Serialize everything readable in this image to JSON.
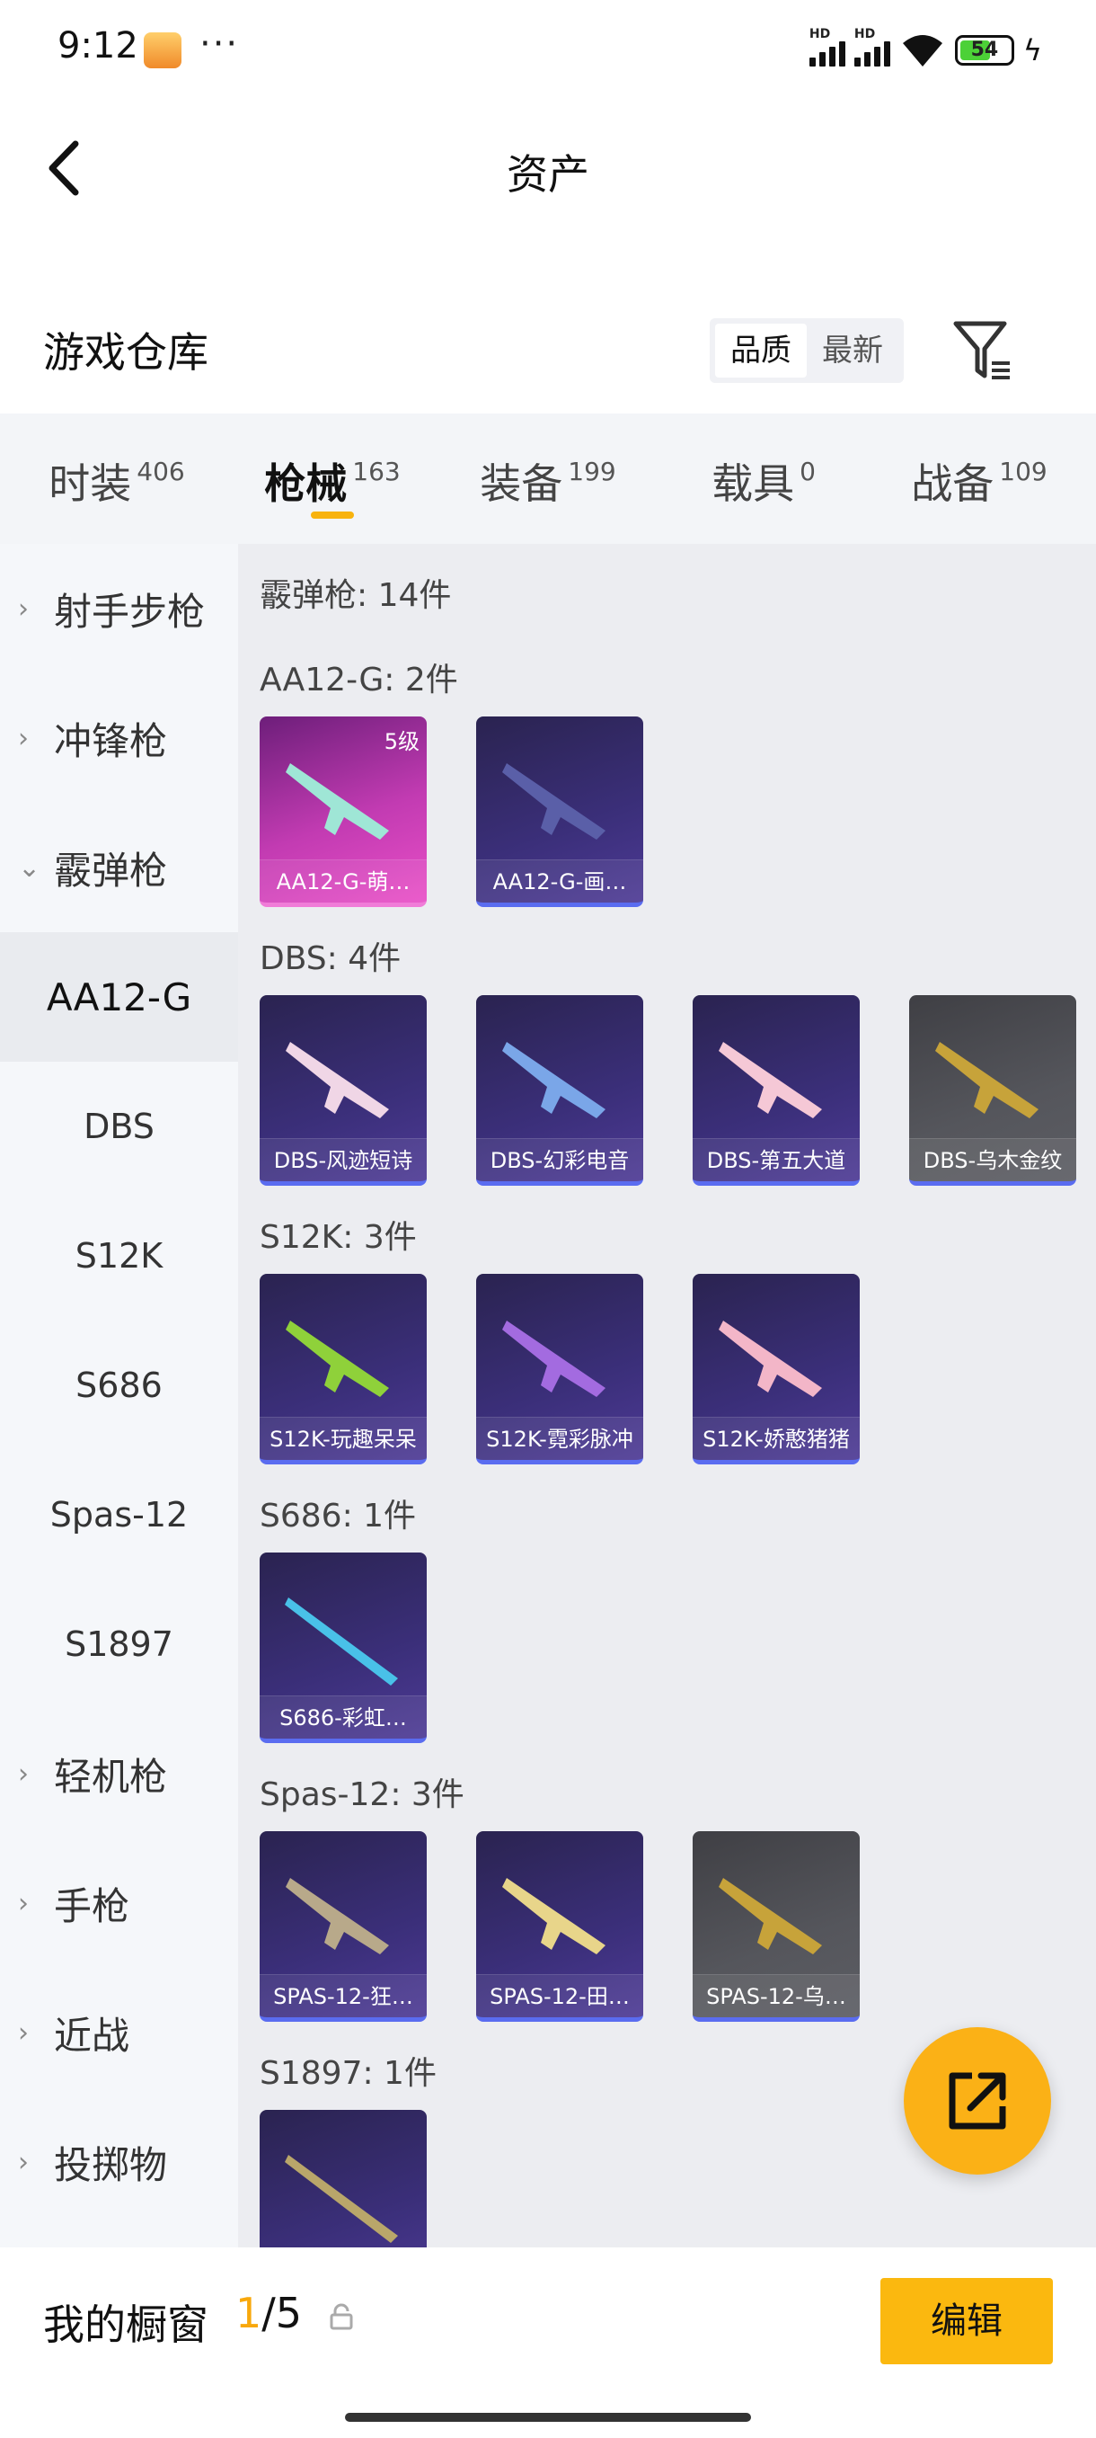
{
  "status": {
    "time": "9:12",
    "dots": "···",
    "battery": "54",
    "net1": "HD",
    "net2": "HD"
  },
  "header": {
    "title": "资产"
  },
  "warehouse": {
    "title": "游戏仓库",
    "sort_quality": "品质",
    "sort_newest": "最新"
  },
  "tabs": [
    {
      "label": "时装",
      "count": "406"
    },
    {
      "label": "枪械",
      "count": "163"
    },
    {
      "label": "装备",
      "count": "199"
    },
    {
      "label": "载具",
      "count": "0"
    },
    {
      "label": "战备",
      "count": "109"
    }
  ],
  "sidebar": {
    "items": [
      {
        "label": "射手步枪"
      },
      {
        "label": "冲锋枪"
      },
      {
        "label": "霰弹枪"
      }
    ],
    "subs": [
      {
        "label": "AA12-G"
      },
      {
        "label": "DBS"
      },
      {
        "label": "S12K"
      },
      {
        "label": "S686"
      },
      {
        "label": "Spas-12"
      },
      {
        "label": "S1897"
      }
    ],
    "items2": [
      {
        "label": "轻机枪"
      },
      {
        "label": "手枪"
      },
      {
        "label": "近战"
      },
      {
        "label": "投掷物"
      }
    ]
  },
  "main": {
    "category": "霰弹枪: 14件",
    "groups": [
      {
        "title": "AA12-G: 2件",
        "cards": [
          {
            "name": "AA12-G-萌…",
            "level": "5级"
          },
          {
            "name": "AA12-G-画…",
            "level": ""
          }
        ]
      },
      {
        "title": "DBS: 4件",
        "cards": [
          {
            "name": "DBS-风迹短诗",
            "level": ""
          },
          {
            "name": "DBS-幻彩电音",
            "level": ""
          },
          {
            "name": "DBS-第五大道",
            "level": ""
          },
          {
            "name": "DBS-乌木金纹",
            "level": ""
          }
        ]
      },
      {
        "title": "S12K: 3件",
        "cards": [
          {
            "name": "S12K-玩趣呆呆",
            "level": ""
          },
          {
            "name": "S12K-霓彩脉冲",
            "level": ""
          },
          {
            "name": "S12K-娇憨猪猪",
            "level": ""
          }
        ]
      },
      {
        "title": "S686: 1件",
        "cards": [
          {
            "name": "S686-彩虹…",
            "level": ""
          }
        ]
      },
      {
        "title": "Spas-12: 3件",
        "cards": [
          {
            "name": "SPAS-12-狂…",
            "level": ""
          },
          {
            "name": "SPAS-12-田…",
            "level": ""
          },
          {
            "name": "SPAS-12-乌…",
            "level": ""
          }
        ]
      },
      {
        "title": "S1897: 1件",
        "cards": [
          {
            "name": "",
            "level": ""
          }
        ]
      }
    ]
  },
  "bottom": {
    "label": "我的橱窗",
    "current": "1",
    "total": "/5",
    "edit": "编辑"
  },
  "colors": {
    "accent": "#fbb80f",
    "tab_underline": "#f8b30e"
  },
  "icons": [
    "back-icon",
    "filter-icon",
    "share-icon",
    "lock-icon",
    "chevron-right-icon",
    "chevron-down-icon"
  ]
}
